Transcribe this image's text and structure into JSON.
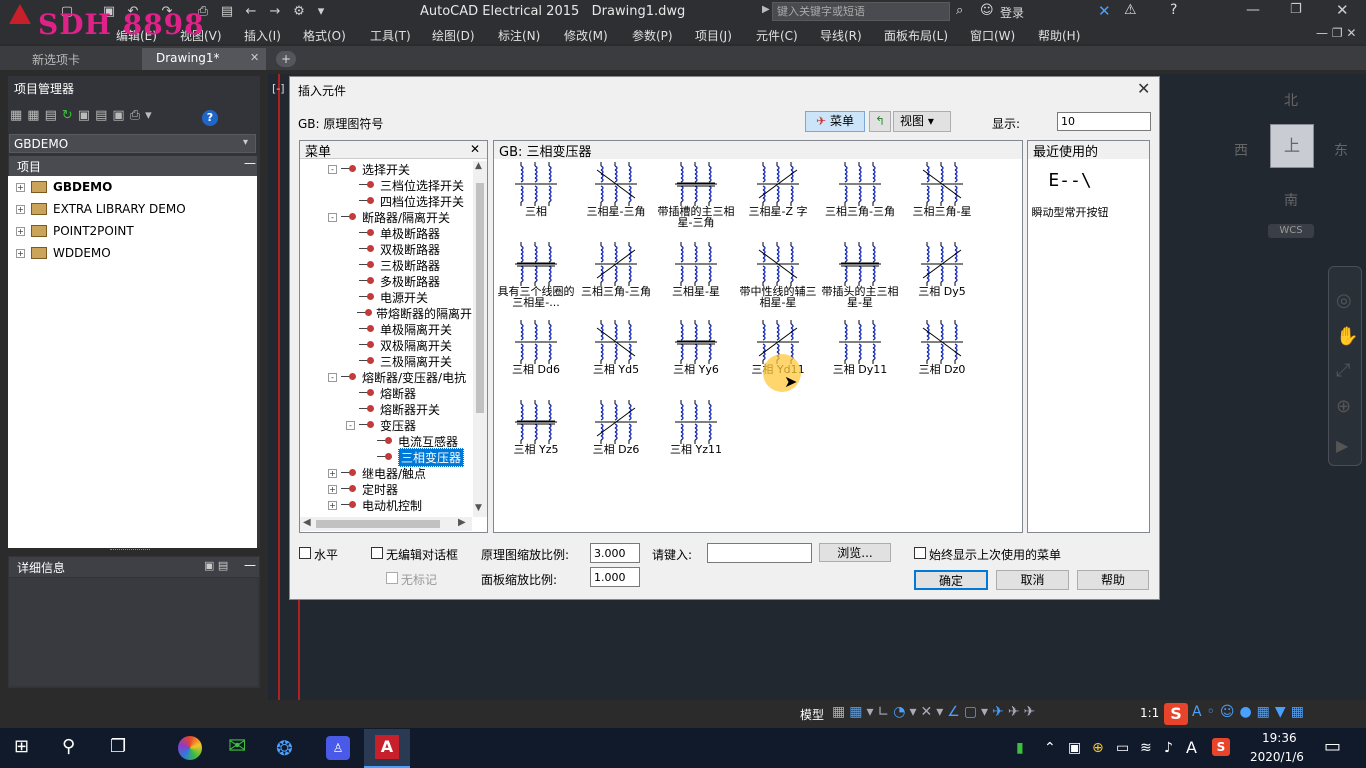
{
  "window": {
    "app_title": "AutoCAD Electrical 2015",
    "doc_title": "Drawing1.dwg",
    "search_placeholder": "键入关键字或短语",
    "login": "登录",
    "watermark": "SDH 8898"
  },
  "menus": [
    "编辑(E)",
    "视图(V)",
    "插入(I)",
    "格式(O)",
    "工具(T)",
    "绘图(D)",
    "标注(N)",
    "修改(M)",
    "参数(P)",
    "项目(J)",
    "元件(C)",
    "导线(R)",
    "面板布局(L)",
    "窗口(W)",
    "帮助(H)"
  ],
  "tabs": [
    {
      "label": "新选项卡"
    },
    {
      "label": "Drawing1*"
    }
  ],
  "project_manager": {
    "title": "项目管理器",
    "selected_project": "GBDEMO",
    "section": "项目",
    "projects": [
      "GBDEMO",
      "EXTRA LIBRARY DEMO",
      "POINT2POINT",
      "WDDEMO"
    ],
    "details_title": "详细信息"
  },
  "drawing": {
    "viewport_label": "[-]",
    "viewcube": {
      "north": "北",
      "south": "南",
      "east": "东",
      "west": "西",
      "top": "上",
      "wcs": "WCS"
    }
  },
  "dialog": {
    "title": "插入元件",
    "library": "GB: 原理图符号",
    "menu_btn": "菜单",
    "view_btn": "视图",
    "display_label": "显示:",
    "display_value": "10",
    "tree_title": "菜单",
    "tree_items": [
      {
        "label": "选择开关",
        "level": 1,
        "expand": "-"
      },
      {
        "label": "三档位选择开关",
        "level": 2
      },
      {
        "label": "四档位选择开关",
        "level": 2
      },
      {
        "label": "断路器/隔离开关",
        "level": 1,
        "expand": "-"
      },
      {
        "label": "单极断路器",
        "level": 2
      },
      {
        "label": "双极断路器",
        "level": 2
      },
      {
        "label": "三极断路器",
        "level": 2
      },
      {
        "label": "多极断路器",
        "level": 2
      },
      {
        "label": "电源开关",
        "level": 2
      },
      {
        "label": "带熔断器的隔离开",
        "level": 2
      },
      {
        "label": "单极隔离开关",
        "level": 2
      },
      {
        "label": "双极隔离开关",
        "level": 2
      },
      {
        "label": "三极隔离开关",
        "level": 2
      },
      {
        "label": "熔断器/变压器/电抗",
        "level": 1,
        "expand": "-"
      },
      {
        "label": "熔断器",
        "level": 2
      },
      {
        "label": "熔断器开关",
        "level": 2
      },
      {
        "label": "变压器",
        "level": 2,
        "expand": "-"
      },
      {
        "label": "电流互感器",
        "level": 3
      },
      {
        "label": "三相变压器",
        "level": 3,
        "selected": true
      },
      {
        "label": "继电器/触点",
        "level": 1,
        "expand": "+"
      },
      {
        "label": "定时器",
        "level": 1,
        "expand": "+"
      },
      {
        "label": "电动机控制",
        "level": 1,
        "expand": "+"
      }
    ],
    "grid_title": "GB: 三相变压器",
    "symbols": [
      {
        "label": "三相"
      },
      {
        "label": "三相星-三角"
      },
      {
        "label": "带插槽的主三相星-三角"
      },
      {
        "label": "三相星-Z 字"
      },
      {
        "label": "三相三角-三角"
      },
      {
        "label": "三相三角-星"
      },
      {
        "label": "具有三个线圈的三相星-..."
      },
      {
        "label": "三相三角-三角"
      },
      {
        "label": "三相星-星"
      },
      {
        "label": "带中性线的辅三相星-星"
      },
      {
        "label": "带插头的主三相星-星"
      },
      {
        "label": "三相 Dy5"
      },
      {
        "label": "三相 Dd6"
      },
      {
        "label": "三相 Yd5"
      },
      {
        "label": "三相 Yy6"
      },
      {
        "label": "三相 Yd11"
      },
      {
        "label": "三相 Dy11"
      },
      {
        "label": "三相 Dz0"
      },
      {
        "label": "三相 Yz5"
      },
      {
        "label": "三相 Dz6"
      },
      {
        "label": "三相 Yz11"
      }
    ],
    "recent_title": "最近使用的",
    "recent_items": [
      {
        "label": "瞬动型常开按钮",
        "glyph": "E--\\"
      }
    ],
    "horizontal": "水平",
    "no_edit": "无编辑对话框",
    "no_tag": "无标记",
    "schematic_scale_label": "原理图缩放比例:",
    "schematic_scale": "3.000",
    "panel_scale_label": "面板缩放比例:",
    "panel_scale": "1.000",
    "input_label": "请键入:",
    "browse": "浏览...",
    "always_show": "始终显示上次使用的菜单",
    "ok": "确定",
    "cancel": "取消",
    "help": "帮助"
  },
  "statusbar": {
    "model": "模型",
    "scale": "1:1"
  },
  "taskbar": {
    "time": "19:36",
    "date": "2020/1/6",
    "ime": "A"
  }
}
